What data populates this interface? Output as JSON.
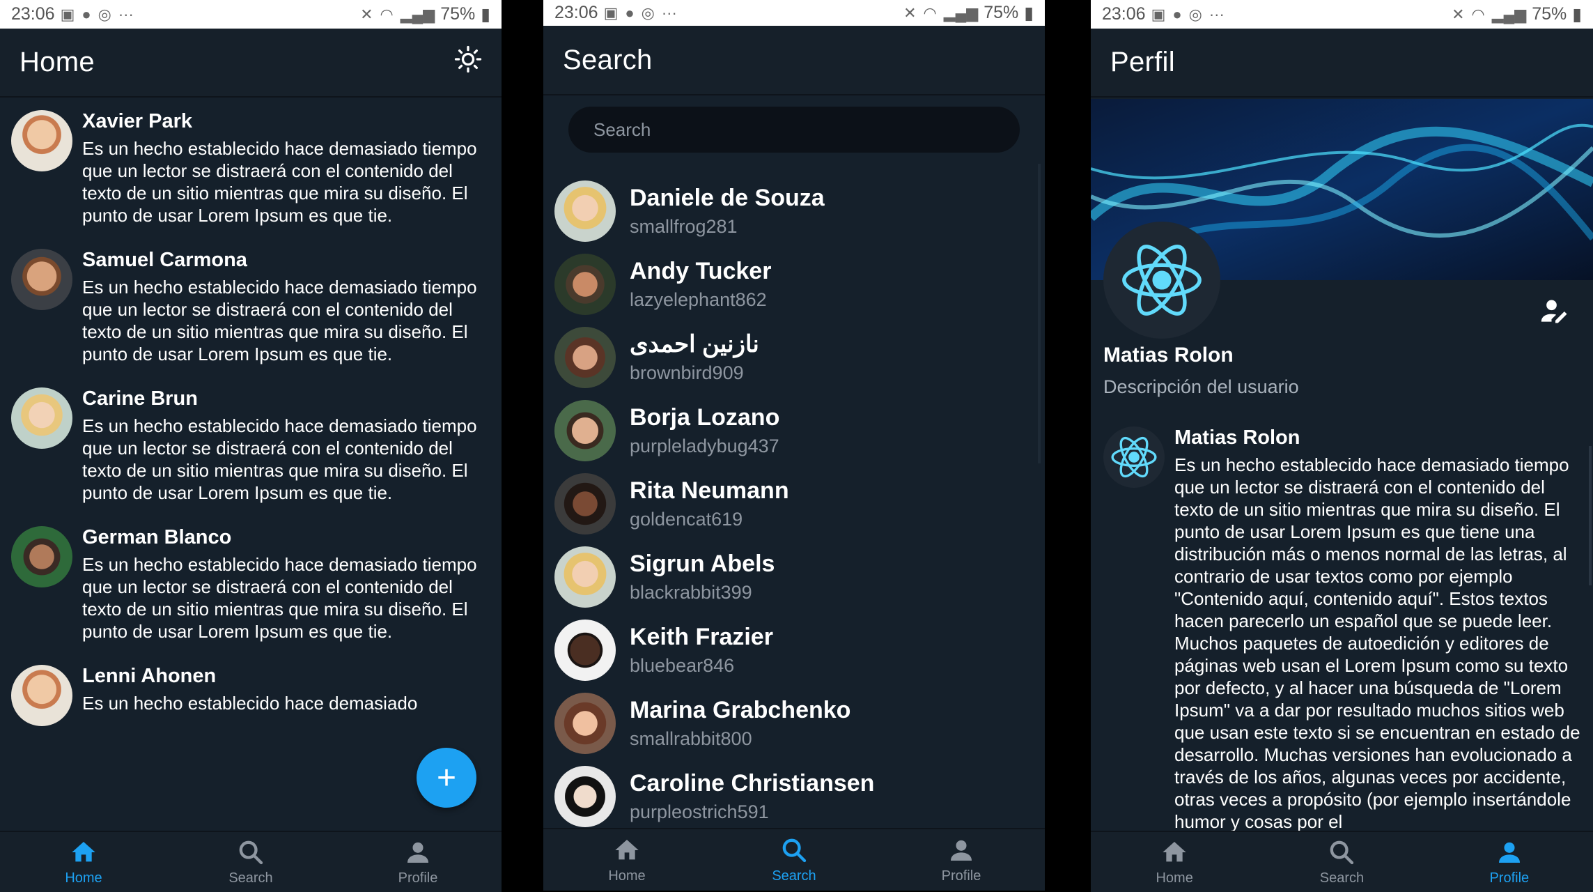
{
  "status": {
    "time": "23:06",
    "battery": "75%"
  },
  "home": {
    "title": "Home",
    "fab_label": "+",
    "posts": [
      {
        "name": "Xavier Park",
        "text": "Es un hecho establecido hace demasiado tiempo que un lector se distraerá con el contenido del texto de un sitio mientras que mira su diseño. El punto de usar Lorem Ipsum es que tie."
      },
      {
        "name": "Samuel Carmona",
        "text": "Es un hecho establecido hace demasiado tiempo que un lector se distraerá con el contenido del texto de un sitio mientras que mira su diseño. El punto de usar Lorem Ipsum es que tie."
      },
      {
        "name": "Carine Brun",
        "text": "Es un hecho establecido hace demasiado tiempo que un lector se distraerá con el contenido del texto de un sitio mientras que mira su diseño. El punto de usar Lorem Ipsum es que tie."
      },
      {
        "name": "German Blanco",
        "text": "Es un hecho establecido hace demasiado tiempo que un lector se distraerá con el contenido del texto de un sitio mientras que mira su diseño. El punto de usar Lorem Ipsum es que tie."
      },
      {
        "name": "Lenni Ahonen",
        "text": "Es un hecho establecido hace demasiado"
      }
    ]
  },
  "search": {
    "title": "Search",
    "placeholder": "Search",
    "results": [
      {
        "name": "Daniele de Souza",
        "user": "smallfrog281"
      },
      {
        "name": "Andy Tucker",
        "user": "lazyelephant862"
      },
      {
        "name": "نازنین احمدی",
        "user": "brownbird909"
      },
      {
        "name": "Borja Lozano",
        "user": "purpleladybug437"
      },
      {
        "name": "Rita Neumann",
        "user": "goldencat619"
      },
      {
        "name": "Sigrun Abels",
        "user": "blackrabbit399"
      },
      {
        "name": "Keith Frazier",
        "user": "bluebear846"
      },
      {
        "name": "Marina Grabchenko",
        "user": "smallrabbit800"
      },
      {
        "name": "Caroline Christiansen",
        "user": "purpleostrich591"
      }
    ]
  },
  "profile": {
    "title": "Perfil",
    "name": "Matias Rolon",
    "description": "Descripción del usuario",
    "post": {
      "name": "Matias Rolon",
      "text": "Es un hecho establecido hace demasiado tiempo que un lector se distraerá con el contenido del texto de un sitio mientras que mira su diseño. El punto de usar Lorem Ipsum es que tiene una distribución más o menos normal de las letras, al contrario de usar textos como por ejemplo \"Contenido aquí, contenido aquí\". Estos textos hacen parecerlo un español que se puede leer. Muchos paquetes de autoedición y editores de páginas web usan el Lorem Ipsum como su texto por defecto, y al hacer una búsqueda de \"Lorem Ipsum\" va a dar por resultado muchos sitios web que usan este texto si se encuentran en estado de desarrollo. Muchas versiones han evolucionado a través de los años, algunas veces por accidente, otras veces a propósito (por ejemplo insertándole humor y cosas por el"
    }
  },
  "nav": {
    "home": "Home",
    "search": "Search",
    "profile": "Profile"
  },
  "colors": {
    "accent": "#1da1f2",
    "background": "#15202b",
    "inactive": "#8e96a0"
  }
}
